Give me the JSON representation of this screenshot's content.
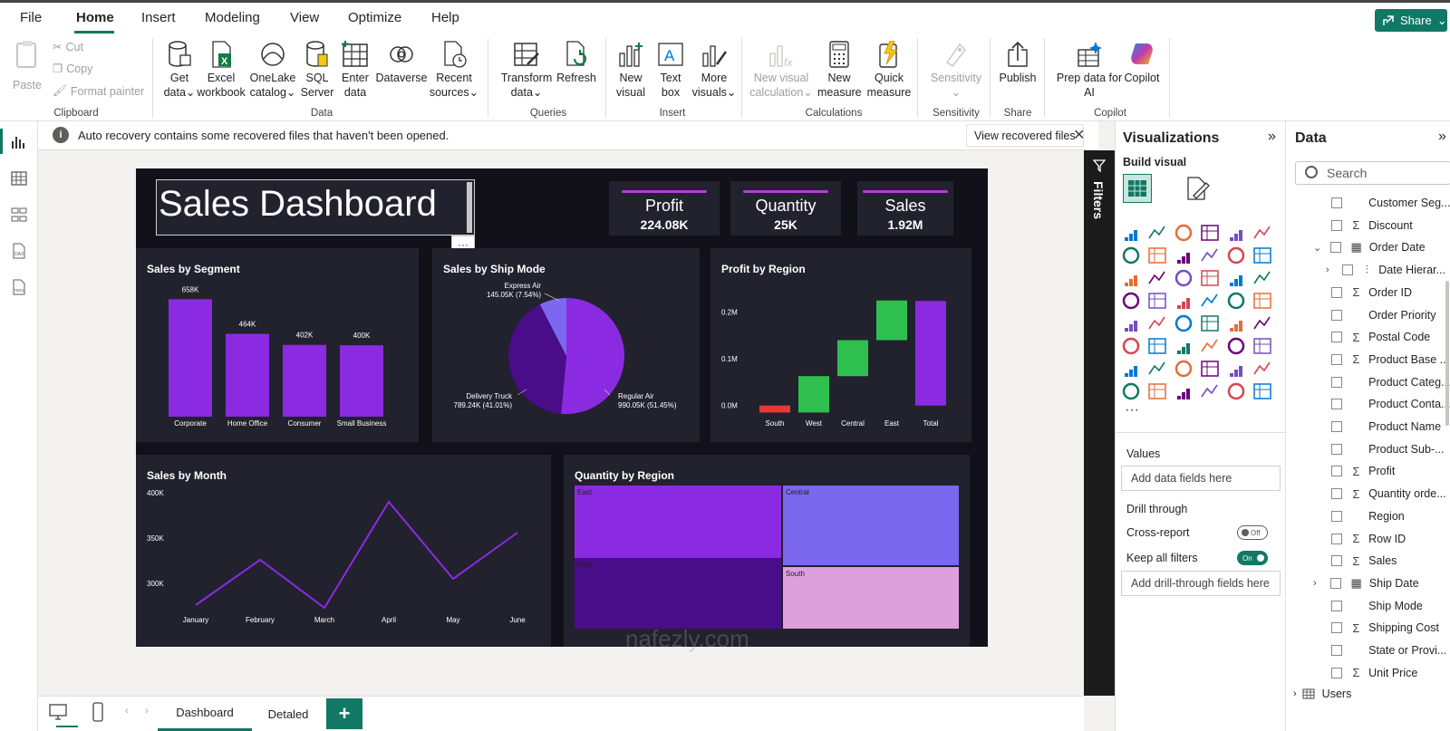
{
  "menu": {
    "items": [
      "File",
      "Home",
      "Insert",
      "Modeling",
      "View",
      "Optimize",
      "Help"
    ],
    "active": "Home",
    "share_label": "Share"
  },
  "ribbon": {
    "clipboard": {
      "paste": "Paste",
      "cut": "Cut",
      "copy": "Copy",
      "format_painter": "Format painter",
      "label": "Clipboard"
    },
    "data": {
      "get_data": [
        "Get",
        "data"
      ],
      "excel": [
        "Excel",
        "workbook"
      ],
      "onelake": [
        "OneLake",
        "catalog"
      ],
      "sql": [
        "SQL",
        "Server"
      ],
      "enter": [
        "Enter",
        "data"
      ],
      "dataverse": [
        "Dataverse"
      ],
      "recent": [
        "Recent",
        "sources"
      ],
      "label": "Data"
    },
    "queries": {
      "transform": [
        "Transform",
        "data"
      ],
      "refresh": [
        "Refresh",
        ""
      ],
      "label": "Queries"
    },
    "insert": {
      "new_visual": [
        "New",
        "visual"
      ],
      "text_box": [
        "Text",
        "box"
      ],
      "more_visuals": [
        "More",
        "visuals"
      ],
      "label": "Insert"
    },
    "calculations": {
      "new_visual_calc": [
        "New visual",
        "calculation"
      ],
      "new_measure": [
        "New",
        "measure"
      ],
      "quick_measure": [
        "Quick",
        "measure"
      ],
      "label": "Calculations"
    },
    "sensitivity": {
      "btn": [
        "Sensitivity",
        ""
      ],
      "label": "Sensitivity"
    },
    "share": {
      "publish": [
        "Publish",
        ""
      ],
      "label": "Share"
    },
    "copilot": {
      "prep": [
        "Prep data for",
        "AI"
      ],
      "copilot": [
        "Copilot",
        ""
      ],
      "label": "Copilot"
    }
  },
  "infobar": {
    "message": "Auto recovery contains some recovered files that haven't been opened.",
    "button": "View recovered files"
  },
  "report": {
    "title": "Sales Dashboard",
    "kpis": [
      {
        "label": "Profit",
        "value": "224.08K"
      },
      {
        "label": "Quantity",
        "value": "25K"
      },
      {
        "label": "Sales",
        "value": "1.92M"
      }
    ],
    "more_dots": "···"
  },
  "colors": {
    "accent": "#117865",
    "report_bg": "#12111a",
    "card_bg": "#22212e",
    "bar": "#8a2be2",
    "kpi_bar": "#b23fd6",
    "green": "#2fbf4f",
    "red": "#e53935"
  },
  "chart_data": [
    {
      "type": "bar",
      "title": "Sales by Segment",
      "categories": [
        "Corporate",
        "Home Office",
        "Consumer",
        "Small Business"
      ],
      "values": [
        658,
        464,
        402,
        400
      ],
      "data_labels": [
        "658K",
        "464K",
        "402K",
        "400K"
      ],
      "ylim": [
        0,
        700
      ]
    },
    {
      "type": "pie",
      "title": "Sales by Ship Mode",
      "slices": [
        {
          "name": "Regular Air",
          "value": 51.45,
          "label": "990.05K (51.45%)",
          "color": "#8a2be2"
        },
        {
          "name": "Delivery Truck",
          "value": 41.01,
          "label": "789.24K (41.01%)",
          "color": "#4a0d8a"
        },
        {
          "name": "Express Air",
          "value": 7.54,
          "label": "145.05K (7.54%)",
          "color": "#7b68ee"
        }
      ]
    },
    {
      "type": "waterfall",
      "title": "Profit by Region",
      "categories": [
        "South",
        "West",
        "Central",
        "East",
        "Total"
      ],
      "values": [
        -0.015,
        0.078,
        0.077,
        0.085,
        0.224
      ],
      "y_ticks": [
        "0.2M",
        "0.1M",
        "0.0M"
      ],
      "ylim": [
        -0.02,
        0.24
      ]
    },
    {
      "type": "line",
      "title": "Sales by Month",
      "categories": [
        "January",
        "February",
        "March",
        "April",
        "May",
        "June"
      ],
      "values": [
        276,
        326,
        273,
        390,
        305,
        356
      ],
      "y_ticks": [
        "400K",
        "350K",
        "300K"
      ],
      "ylim": [
        262,
        402
      ]
    },
    {
      "type": "treemap",
      "title": "Quantity by Region",
      "tiles": [
        {
          "name": "East",
          "color": "#8a2be2"
        },
        {
          "name": "Central",
          "color": "#7b68ee"
        },
        {
          "name": "West",
          "color": "#4a0d8a"
        },
        {
          "name": "South",
          "color": "#dda0dd"
        }
      ]
    }
  ],
  "filters_label": "Filters",
  "visualizations": {
    "title": "Visualizations",
    "build_visual": "Build visual",
    "more": "···",
    "values_label": "Values",
    "values_placeholder": "Add data fields here",
    "drill_through": "Drill through",
    "cross_report": "Cross-report",
    "cross_report_state": "Off",
    "keep_filters": "Keep all filters",
    "keep_filters_state": "On",
    "drill_placeholder": "Add drill-through fields here"
  },
  "data_pane": {
    "title": "Data",
    "search_placeholder": "Search",
    "fields": [
      {
        "name": "Customer Seg...",
        "sym": "",
        "chev": ""
      },
      {
        "name": "Discount",
        "sym": "Σ",
        "chev": ""
      },
      {
        "name": "Order Date",
        "sym": "▦",
        "chev": "⌄"
      },
      {
        "name": "Date Hierar...",
        "sym": "⫶",
        "chev": "›",
        "indent": true
      },
      {
        "name": "Order ID",
        "sym": "Σ",
        "chev": ""
      },
      {
        "name": "Order Priority",
        "sym": "",
        "chev": ""
      },
      {
        "name": "Postal Code",
        "sym": "Σ",
        "chev": ""
      },
      {
        "name": "Product Base ...",
        "sym": "Σ",
        "chev": ""
      },
      {
        "name": "Product Categ...",
        "sym": "",
        "chev": ""
      },
      {
        "name": "Product Conta...",
        "sym": "",
        "chev": ""
      },
      {
        "name": "Product Name",
        "sym": "",
        "chev": ""
      },
      {
        "name": "Product Sub-...",
        "sym": "",
        "chev": ""
      },
      {
        "name": "Profit",
        "sym": "Σ",
        "chev": ""
      },
      {
        "name": "Quantity orde...",
        "sym": "Σ",
        "chev": ""
      },
      {
        "name": "Region",
        "sym": "",
        "chev": ""
      },
      {
        "name": "Row ID",
        "sym": "Σ",
        "chev": ""
      },
      {
        "name": "Sales",
        "sym": "Σ",
        "chev": ""
      },
      {
        "name": "Ship Date",
        "sym": "▦",
        "chev": "›"
      },
      {
        "name": "Ship Mode",
        "sym": "",
        "chev": ""
      },
      {
        "name": "Shipping Cost",
        "sym": "Σ",
        "chev": ""
      },
      {
        "name": "State or Provi...",
        "sym": "",
        "chev": ""
      },
      {
        "name": "Unit Price",
        "sym": "Σ",
        "chev": ""
      }
    ],
    "table": "Users"
  },
  "pages": {
    "tabs": [
      "Dashboard",
      "Detaled"
    ],
    "add": "+"
  },
  "watermark": "nafezly.com"
}
